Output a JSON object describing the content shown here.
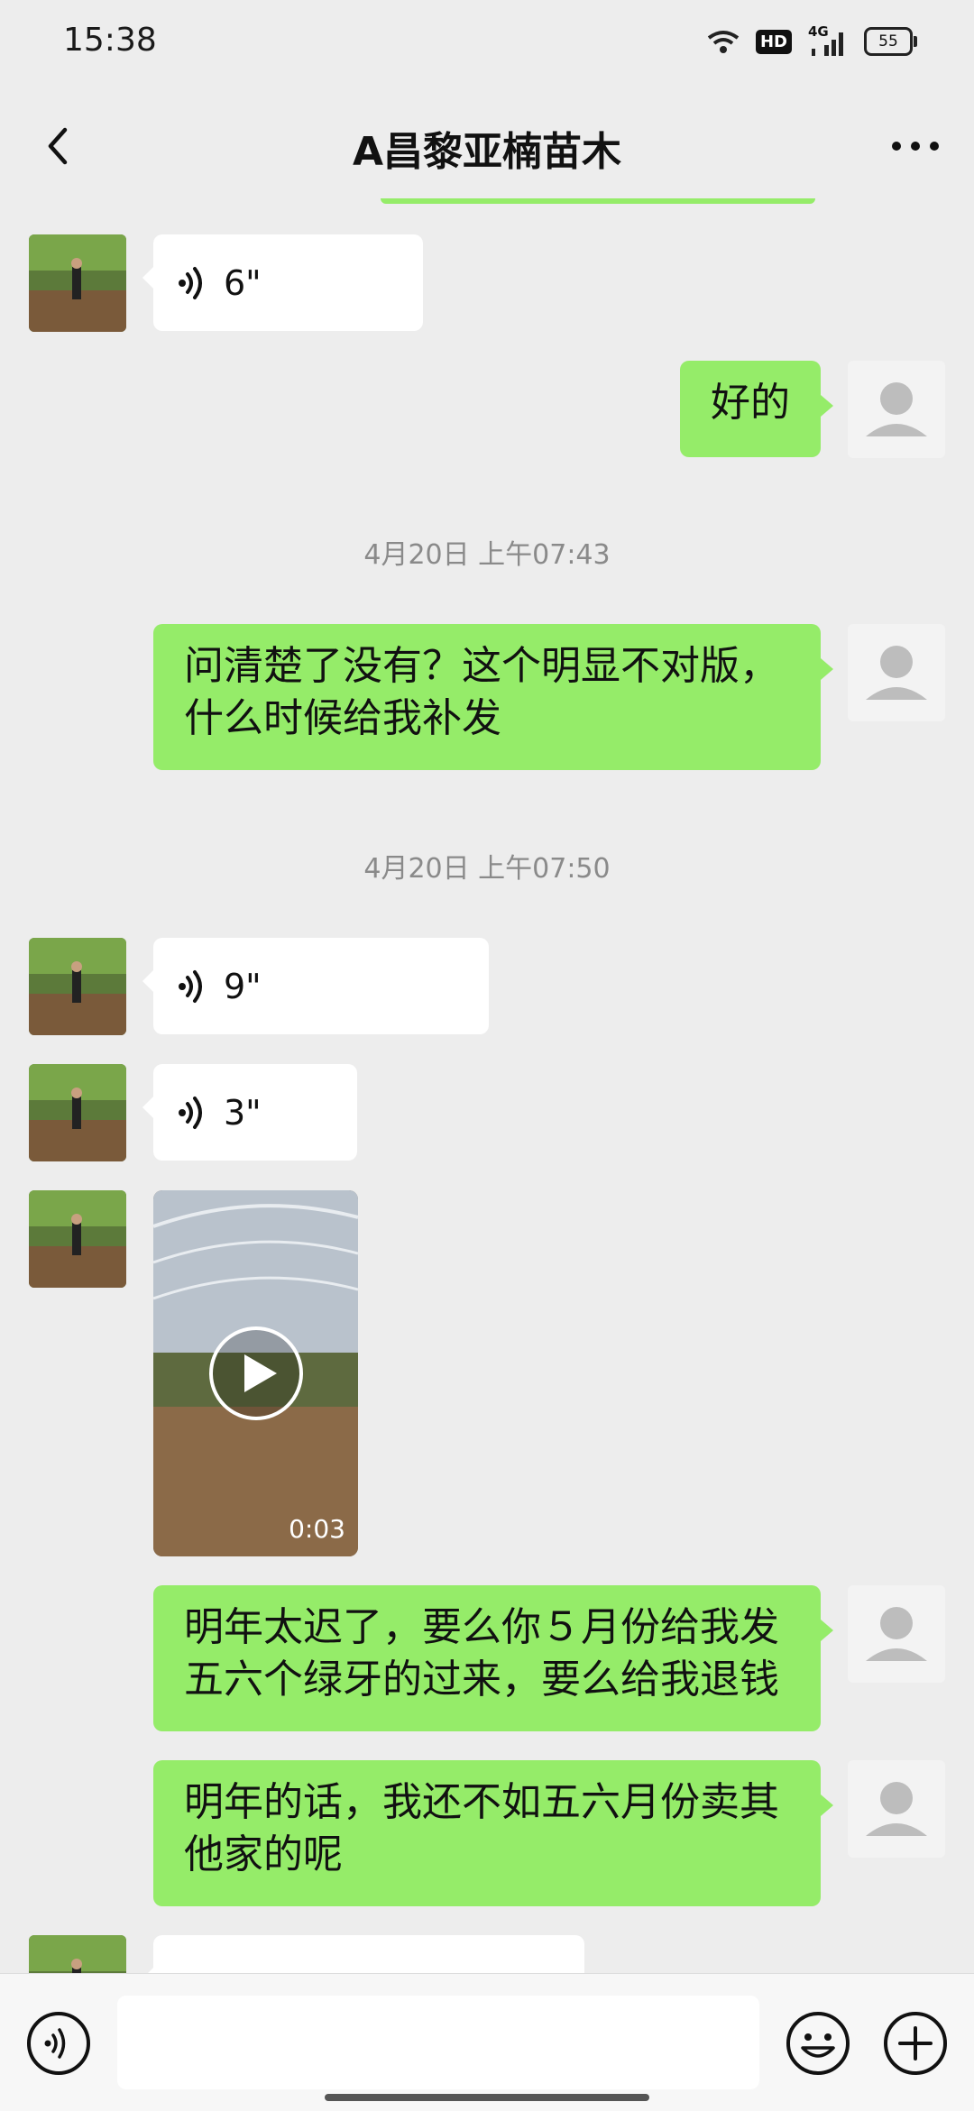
{
  "status_bar": {
    "time": "15:38",
    "hd": "HD",
    "network": "4G",
    "battery": "55"
  },
  "header": {
    "title": "A昌黎亚楠苗木",
    "back_icon": "chevron-left-icon",
    "more_icon": "more-dots-icon"
  },
  "messages": [
    {
      "side": "left",
      "type": "voice",
      "duration": "6\""
    },
    {
      "side": "right",
      "type": "text",
      "lines": [
        "好的"
      ]
    },
    {
      "type": "timestamp",
      "text": "4月20日 上午07:43"
    },
    {
      "side": "right",
      "type": "text",
      "lines": [
        "问清楚了没有？这个明显不对版，",
        "什么时候给我补发"
      ]
    },
    {
      "type": "timestamp",
      "text": "4月20日 上午07:50"
    },
    {
      "side": "left",
      "type": "voice",
      "duration": "9\""
    },
    {
      "side": "left",
      "type": "voice",
      "duration": "3\""
    },
    {
      "side": "left",
      "type": "video",
      "duration": "0:03"
    },
    {
      "side": "right",
      "type": "text",
      "lines": [
        "明年太迟了，要么你５月份给我发",
        "五六个绿牙的过来，要么给我退钱"
      ]
    },
    {
      "side": "right",
      "type": "text",
      "lines": [
        "明年的话，我还不如五六月份卖其",
        "他家的呢"
      ]
    }
  ],
  "input_bar": {
    "input_value": "",
    "voice_icon": "voice-mode-icon",
    "emoji_icon": "emoji-icon",
    "plus_icon": "plus-icon"
  },
  "colors": {
    "bubble_green": "#95ec69",
    "background": "#ededed",
    "bubble_white": "#ffffff"
  }
}
